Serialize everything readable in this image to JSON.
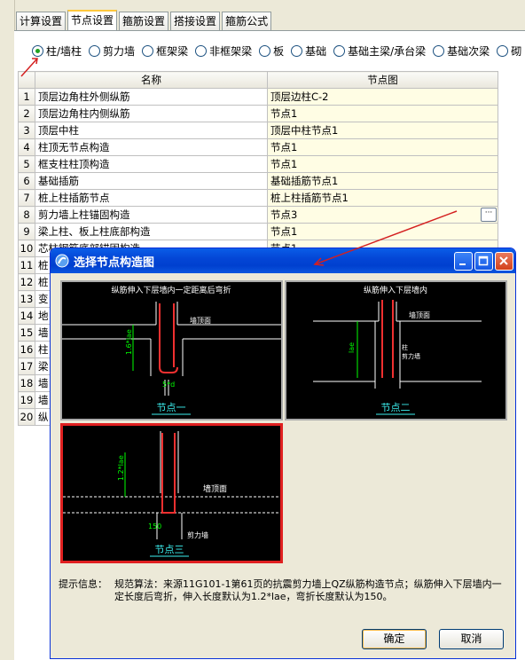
{
  "tabs": [
    "计算设置",
    "节点设置",
    "箍筋设置",
    "搭接设置",
    "箍筋公式"
  ],
  "active_tab": 1,
  "radios": [
    {
      "label": "柱/墙柱",
      "checked": true
    },
    {
      "label": "剪力墙",
      "checked": false
    },
    {
      "label": "框架梁",
      "checked": false
    },
    {
      "label": "非框架梁",
      "checked": false
    },
    {
      "label": "板",
      "checked": false
    },
    {
      "label": "基础",
      "checked": false
    },
    {
      "label": "基础主梁/承台梁",
      "checked": false
    },
    {
      "label": "基础次梁",
      "checked": false
    },
    {
      "label": "砌",
      "checked": false
    }
  ],
  "table": {
    "headers": [
      "名称",
      "节点图"
    ],
    "rows": [
      {
        "no": "1",
        "name": "顶层边角柱外侧纵筋",
        "value": "顶层边柱C-2"
      },
      {
        "no": "2",
        "name": "顶层边角柱内侧纵筋",
        "value": "节点1"
      },
      {
        "no": "3",
        "name": "顶层中柱",
        "value": "顶层中柱节点1"
      },
      {
        "no": "4",
        "name": "柱顶无节点构造",
        "value": "节点1"
      },
      {
        "no": "5",
        "name": "框支柱柱顶构造",
        "value": "节点1"
      },
      {
        "no": "6",
        "name": "基础插筋",
        "value": "基础插筋节点1"
      },
      {
        "no": "7",
        "name": "桩上柱插筋节点",
        "value": "桩上柱插筋节点1"
      },
      {
        "no": "8",
        "name": "剪力墙上柱锚固构造",
        "value": "节点3"
      },
      {
        "no": "9",
        "name": "梁上柱、板上柱底部构造",
        "value": "节点1"
      },
      {
        "no": "10",
        "name": "芯柱钢筋底部锚固构造",
        "value": "节点1"
      },
      {
        "no": "11",
        "name": "桩",
        "value": ""
      },
      {
        "no": "12",
        "name": "桩",
        "value": ""
      },
      {
        "no": "13",
        "name": "变",
        "value": ""
      },
      {
        "no": "14",
        "name": "地",
        "value": ""
      },
      {
        "no": "15",
        "name": "墙",
        "value": ""
      },
      {
        "no": "16",
        "name": "柱",
        "value": ""
      },
      {
        "no": "17",
        "name": "梁",
        "value": ""
      },
      {
        "no": "18",
        "name": "墙",
        "value": ""
      },
      {
        "no": "19",
        "name": "墙",
        "value": ""
      },
      {
        "no": "20",
        "name": "纵",
        "value": ""
      }
    ],
    "more_button_label": "···"
  },
  "dialog": {
    "title": "选择节点构造图",
    "thumbs": [
      {
        "heading": "纵筋伸入下层墙内一定距离后弯折",
        "caption": "节点一",
        "labels": [
          "墙顶面",
          "1.6*lae",
          "5*d"
        ]
      },
      {
        "heading": "纵筋伸入下层墙内",
        "caption": "节点二",
        "labels": [
          "墙顶面",
          "柱",
          "剪力墙",
          "lae"
        ]
      },
      {
        "heading": "",
        "caption": "节点三",
        "labels": [
          "墙顶面",
          "1.2*lae",
          "150",
          "剪力墙"
        ]
      }
    ],
    "hint_label": "提示信息：",
    "hint_text": "规范算法：来源11G101-1第61页的抗震剪力墙上QZ纵筋构造节点；纵筋伸入下层墙内一定长度后弯折，伸入长度默认为1.2*lae，弯折长度默认为150。",
    "ok_label": "确定",
    "cancel_label": "取消"
  },
  "colors": {
    "highlight_cell": "#fffde4",
    "titlebar": "#0446d6",
    "selection": "#e02020",
    "annotation_arrow": "#d42020"
  }
}
